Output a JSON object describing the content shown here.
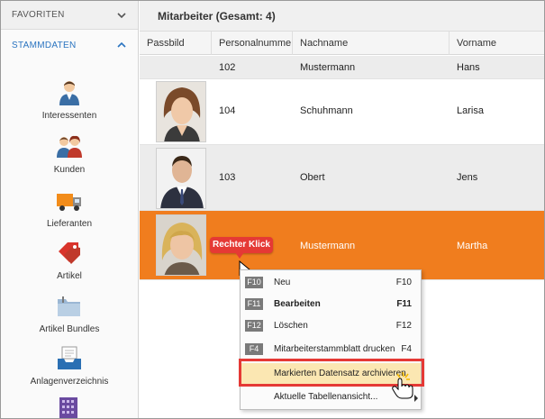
{
  "sidebar": {
    "favoriten_label": "FAVORITEN",
    "stammdaten_label": "STAMMDATEN",
    "items": [
      {
        "label": "Interessenten",
        "icon": "person-icon"
      },
      {
        "label": "Kunden",
        "icon": "customers-icon"
      },
      {
        "label": "Lieferanten",
        "icon": "truck-icon"
      },
      {
        "label": "Artikel",
        "icon": "tag-icon"
      },
      {
        "label": "Artikel Bundles",
        "icon": "folder-icon"
      },
      {
        "label": "Anlagenverzeichnis",
        "icon": "inbox-icon"
      }
    ]
  },
  "main": {
    "title": "Mitarbeiter (Gesamt: 4)",
    "columns": [
      "Passbild",
      "Personalnumme",
      "Nachname",
      "Vorname"
    ],
    "rows": [
      {
        "nr": "102",
        "nachname": "Mustermann",
        "vorname": "Hans"
      },
      {
        "nr": "104",
        "nachname": "Schuhmann",
        "vorname": "Larisa"
      },
      {
        "nr": "103",
        "nachname": "Obert",
        "vorname": "Jens"
      },
      {
        "nr": "",
        "nachname": "Mustermann",
        "vorname": "Martha"
      }
    ]
  },
  "callout": "Rechter Klick",
  "context_menu": [
    {
      "key": "F10",
      "label": "Neu",
      "shortcut": "F10"
    },
    {
      "key": "F11",
      "label": "Bearbeiten",
      "shortcut": "F11"
    },
    {
      "key": "F12",
      "label": "Löschen",
      "shortcut": "F12"
    },
    {
      "key": "F4",
      "label": "Mitarbeiterstammblatt drucken",
      "shortcut": "F4"
    },
    {
      "key": "",
      "label": "Markierten Datensatz archivieren",
      "shortcut": ""
    },
    {
      "key": "",
      "label": "Aktuelle Tabellenansicht...",
      "shortcut": ""
    }
  ],
  "colors": {
    "accent": "#2a74c0",
    "selected_row": "#f07d1e",
    "callout": "#e53935",
    "highlight": "#fbe7b2"
  }
}
